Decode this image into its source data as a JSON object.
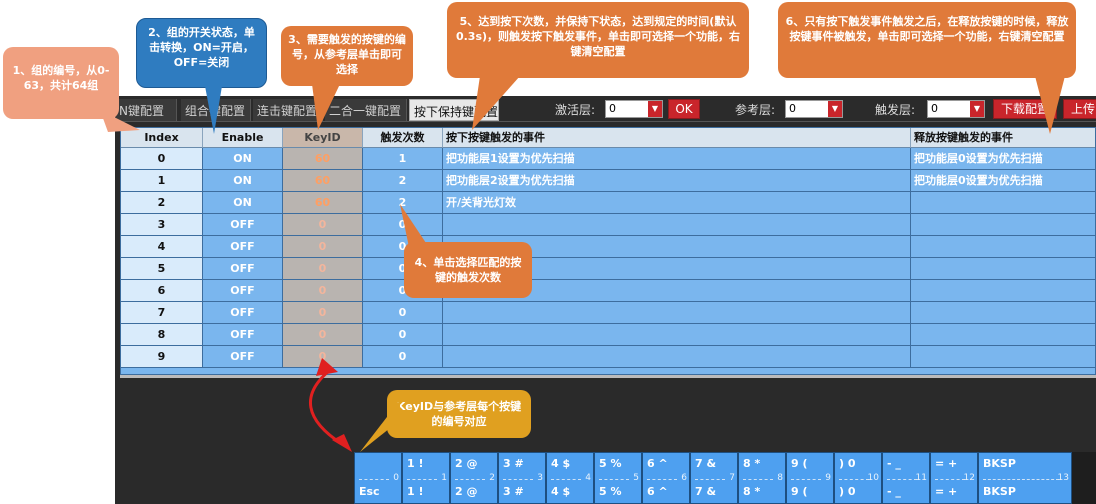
{
  "tabs": [
    "N键配置",
    "组合键配置",
    "连击键配置",
    "二合一键配置",
    "按下保持键配置"
  ],
  "toolbar": {
    "activate_label": "激活层:",
    "activate_value": "0",
    "ok_label": "OK",
    "reference_label": "参考层:",
    "reference_value": "0",
    "trigger_label": "触发层:",
    "trigger_value": "0",
    "download_label": "下载配置",
    "upload_label": "上传"
  },
  "table": {
    "headers": [
      "Index",
      "Enable",
      "KeyID",
      "触发次数",
      "按下按键触发的事件",
      "释放按键触发的事件"
    ],
    "rows": [
      {
        "index": "0",
        "enable": "ON",
        "keyid": "60",
        "count": "1",
        "press": "把功能层1设置为优先扫描",
        "release": "把功能层0设置为优先扫描"
      },
      {
        "index": "1",
        "enable": "ON",
        "keyid": "60",
        "count": "2",
        "press": "把功能层2设置为优先扫描",
        "release": "把功能层0设置为优先扫描"
      },
      {
        "index": "2",
        "enable": "ON",
        "keyid": "60",
        "count": "2",
        "press": "开/关背光灯效",
        "release": ""
      },
      {
        "index": "3",
        "enable": "OFF",
        "keyid": "0",
        "count": "0",
        "press": "",
        "release": ""
      },
      {
        "index": "4",
        "enable": "OFF",
        "keyid": "0",
        "count": "0",
        "press": "",
        "release": ""
      },
      {
        "index": "5",
        "enable": "OFF",
        "keyid": "0",
        "count": "0",
        "press": "",
        "release": ""
      },
      {
        "index": "6",
        "enable": "OFF",
        "keyid": "0",
        "count": "0",
        "press": "",
        "release": ""
      },
      {
        "index": "7",
        "enable": "OFF",
        "keyid": "0",
        "count": "0",
        "press": "",
        "release": ""
      },
      {
        "index": "8",
        "enable": "OFF",
        "keyid": "0",
        "count": "0",
        "press": "",
        "release": ""
      },
      {
        "index": "9",
        "enable": "OFF",
        "keyid": "0",
        "count": "0",
        "press": "",
        "release": ""
      }
    ]
  },
  "callouts": [
    {
      "text": "1、组的编号，从0-63，共计64组"
    },
    {
      "text": "2、组的开关状态，单击转换，ON=开启，OFF=关闭"
    },
    {
      "text": "3、需要触发的按键的编号，从参考层单击即可选择"
    },
    {
      "text": "5、达到按下次数，并保持下状态，达到规定的时间(默认0.3s)，则触发按下触发事件，单击即可选择一个功能，右键清空配置"
    },
    {
      "text": "6、只有按下触发事件触发之后，在释放按键的时候，释放按键事件被触发，单击即可选择一个功能，右键清空配置"
    },
    {
      "text": "4、单击选择匹配的按键的触发次数"
    },
    {
      "text": "KeyID与参考层每个按键的编号对应"
    }
  ],
  "keys": [
    {
      "top": "",
      "bot": "Esc",
      "num": "0"
    },
    {
      "top": "1 !",
      "bot": "1 !",
      "num": "1"
    },
    {
      "top": "2 @",
      "bot": "2 @",
      "num": "2"
    },
    {
      "top": "3 #",
      "bot": "3 #",
      "num": "3"
    },
    {
      "top": "4 $",
      "bot": "4 $",
      "num": "4"
    },
    {
      "top": "5 %",
      "bot": "5 %",
      "num": "5"
    },
    {
      "top": "6 ^",
      "bot": "6 ^",
      "num": "6"
    },
    {
      "top": "7 &",
      "bot": "7 &",
      "num": "7"
    },
    {
      "top": "8 *",
      "bot": "8 *",
      "num": "8"
    },
    {
      "top": "9 (",
      "bot": "9 (",
      "num": "9"
    },
    {
      "top": ") 0",
      "bot": ") 0",
      "num": "10"
    },
    {
      "top": "- _",
      "bot": "- _",
      "num": "11"
    },
    {
      "top": "= +",
      "bot": "= +",
      "num": "12"
    },
    {
      "top": "BKSP",
      "bot": "BKSP",
      "num": "13"
    }
  ],
  "colors": {
    "callout_orange": "#e07a3a",
    "callout_salmon": "#f0a080",
    "callout_blue": "#2f7cc0",
    "callout_gold": "#e0a020",
    "arrow_red": "#e02020"
  }
}
